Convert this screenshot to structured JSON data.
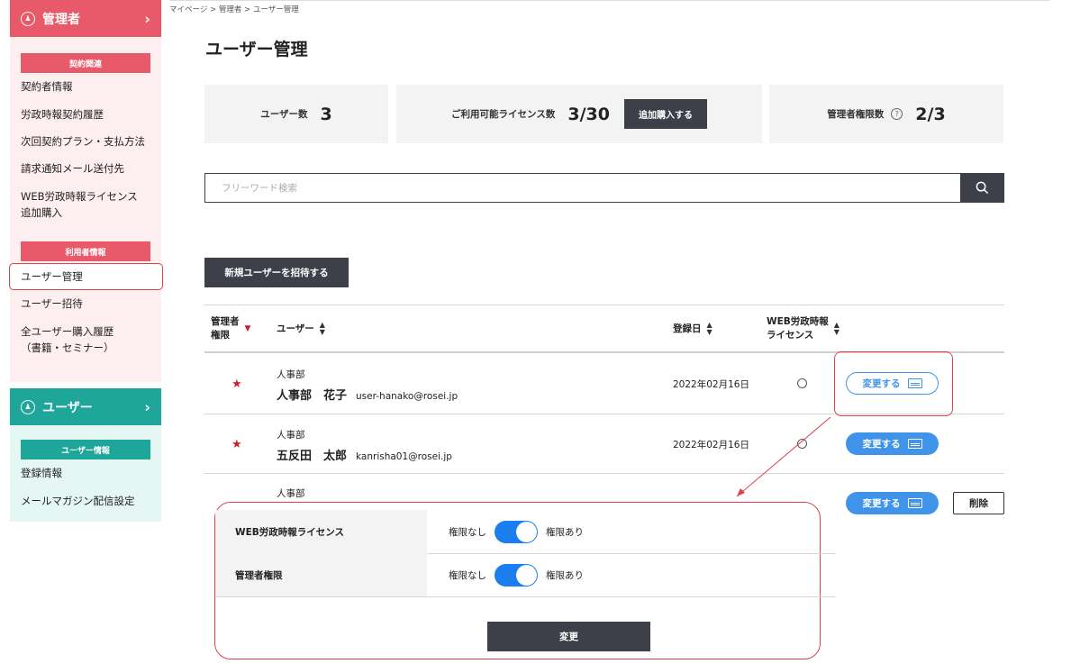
{
  "sidebar": {
    "admin": {
      "title": "管理者",
      "contract_category": "契約関連",
      "items": [
        "契約者情報",
        "労政時報契約履歴",
        "次回契約プラン・支払方法",
        "請求通知メール送付先",
        "WEB労政時報ライセンス",
        "追加購入"
      ],
      "user_category": "利用者情報",
      "user_items": [
        "ユーザー管理",
        "ユーザー招待",
        "全ユーザー購入履歴",
        "（書籍・セミナー）"
      ]
    },
    "user": {
      "title": "ユーザー",
      "category": "ユーザー情報",
      "items": [
        "登録情報",
        "メールマガジン配信設定"
      ]
    }
  },
  "breadcrumb": "マイページ > 管理者 > ユーザー管理",
  "page_title": "ユーザー管理",
  "stats": {
    "users_label": "ユーザー数",
    "users_value": "3",
    "license_label": "ご利用可能ライセンス数",
    "license_value": "3/30",
    "buy_button": "追加購入する",
    "admin_label": "管理者権限数",
    "admin_value": "2/3"
  },
  "search": {
    "placeholder": "フリーワード検索"
  },
  "invite_button": "新規ユーザーを招待する",
  "table": {
    "headers": {
      "admin_line1": "管理者",
      "admin_line2": "権限",
      "user": "ユーザー",
      "date": "登録日",
      "license_line1": "WEB労政時報",
      "license_line2": "ライセンス"
    },
    "sort_up": "▲",
    "sort_down": "▼",
    "rows": [
      {
        "star": "★",
        "dept": "人事部",
        "name": "人事部　花子",
        "email": "user-hanako@rosei.jp",
        "date": "2022年02月16日",
        "change": "変更する"
      },
      {
        "star": "★",
        "dept": "人事部",
        "name": "五反田　太郎",
        "email": "kanrisha01@rosei.jp",
        "date": "2022年02月16日",
        "change": "変更する"
      },
      {
        "dept": "人事部",
        "change": "変更する",
        "delete": "削除"
      }
    ]
  },
  "popup": {
    "rows": [
      {
        "label": "WEB労政時報ライセンス",
        "off": "権限なし",
        "on": "権限あり"
      },
      {
        "label": "管理者権限",
        "off": "権限なし",
        "on": "権限あり"
      }
    ],
    "apply_button": "変更"
  },
  "colors": {
    "admin_accent": "#e8596a",
    "user_accent": "#1fa69a",
    "primary_blue": "#3f94ea",
    "dark_button": "#3e4049",
    "callout_red": "#d9434f"
  }
}
